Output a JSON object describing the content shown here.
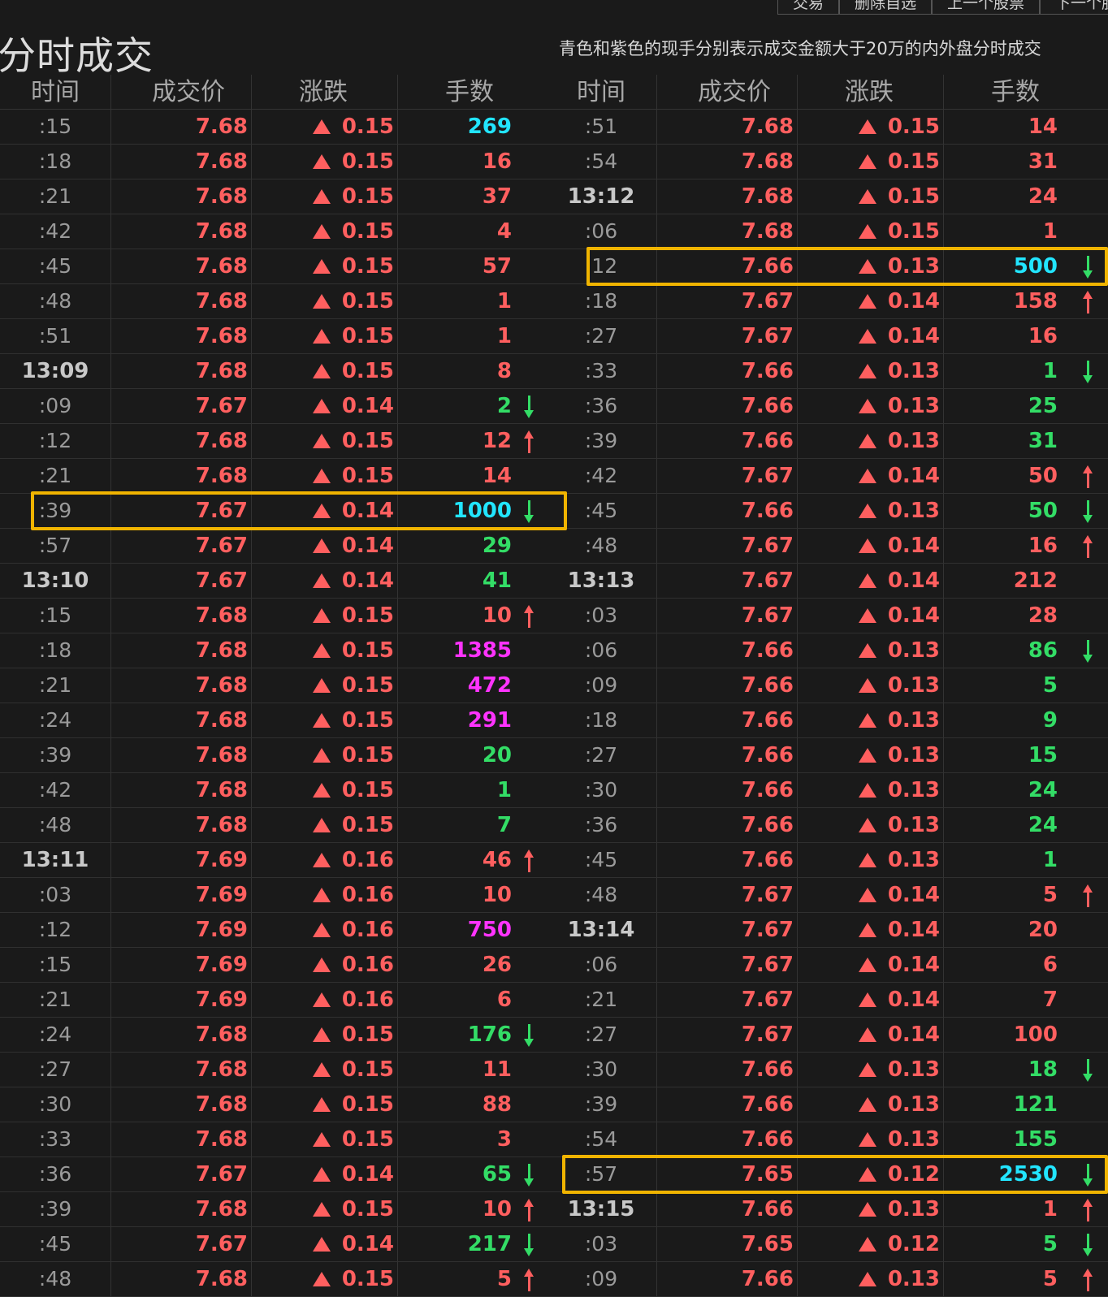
{
  "toolbar": {
    "buttons": [
      "交易",
      "删除自选",
      "上一个股票",
      "下一个股"
    ]
  },
  "title": "分时成交",
  "note": "青色和紫色的现手分别表示成交金额大于20万的内外盘分时成交",
  "columns": [
    "时间",
    "成交价",
    "涨跌",
    "手数"
  ],
  "colors": {
    "up": "#ff5f5f",
    "down": "#33dd66",
    "cyan": "#22e5ff",
    "magenta": "#ff33ff",
    "highlight": "#f0b400"
  },
  "left_rows": [
    {
      "time": ":15",
      "price": "7.68",
      "change": "0.15",
      "volume": "269",
      "vcolor": "cyan",
      "arrow": ""
    },
    {
      "time": ":18",
      "price": "7.68",
      "change": "0.15",
      "volume": "16",
      "vcolor": "up",
      "arrow": ""
    },
    {
      "time": ":21",
      "price": "7.68",
      "change": "0.15",
      "volume": "37",
      "vcolor": "up",
      "arrow": ""
    },
    {
      "time": ":42",
      "price": "7.68",
      "change": "0.15",
      "volume": "4",
      "vcolor": "up",
      "arrow": ""
    },
    {
      "time": ":45",
      "price": "7.68",
      "change": "0.15",
      "volume": "57",
      "vcolor": "up",
      "arrow": ""
    },
    {
      "time": ":48",
      "price": "7.68",
      "change": "0.15",
      "volume": "1",
      "vcolor": "up",
      "arrow": ""
    },
    {
      "time": ":51",
      "price": "7.68",
      "change": "0.15",
      "volume": "1",
      "vcolor": "up",
      "arrow": ""
    },
    {
      "time": "13:09",
      "price": "7.68",
      "change": "0.15",
      "volume": "8",
      "vcolor": "up",
      "arrow": ""
    },
    {
      "time": ":09",
      "price": "7.67",
      "change": "0.14",
      "volume": "2",
      "vcolor": "down",
      "arrow": "down"
    },
    {
      "time": ":12",
      "price": "7.68",
      "change": "0.15",
      "volume": "12",
      "vcolor": "up",
      "arrow": "up"
    },
    {
      "time": ":21",
      "price": "7.68",
      "change": "0.15",
      "volume": "14",
      "vcolor": "up",
      "arrow": ""
    },
    {
      "time": ":39",
      "price": "7.67",
      "change": "0.14",
      "volume": "1000",
      "vcolor": "cyan",
      "arrow": "down"
    },
    {
      "time": ":57",
      "price": "7.67",
      "change": "0.14",
      "volume": "29",
      "vcolor": "down",
      "arrow": ""
    },
    {
      "time": "13:10",
      "price": "7.67",
      "change": "0.14",
      "volume": "41",
      "vcolor": "down",
      "arrow": ""
    },
    {
      "time": ":15",
      "price": "7.68",
      "change": "0.15",
      "volume": "10",
      "vcolor": "up",
      "arrow": "up"
    },
    {
      "time": ":18",
      "price": "7.68",
      "change": "0.15",
      "volume": "1385",
      "vcolor": "magenta",
      "arrow": ""
    },
    {
      "time": ":21",
      "price": "7.68",
      "change": "0.15",
      "volume": "472",
      "vcolor": "magenta",
      "arrow": ""
    },
    {
      "time": ":24",
      "price": "7.68",
      "change": "0.15",
      "volume": "291",
      "vcolor": "magenta",
      "arrow": ""
    },
    {
      "time": ":39",
      "price": "7.68",
      "change": "0.15",
      "volume": "20",
      "vcolor": "down",
      "arrow": ""
    },
    {
      "time": ":42",
      "price": "7.68",
      "change": "0.15",
      "volume": "1",
      "vcolor": "down",
      "arrow": ""
    },
    {
      "time": ":48",
      "price": "7.68",
      "change": "0.15",
      "volume": "7",
      "vcolor": "down",
      "arrow": ""
    },
    {
      "time": "13:11",
      "price": "7.69",
      "change": "0.16",
      "volume": "46",
      "vcolor": "up",
      "arrow": "up"
    },
    {
      "time": ":03",
      "price": "7.69",
      "change": "0.16",
      "volume": "10",
      "vcolor": "up",
      "arrow": ""
    },
    {
      "time": ":12",
      "price": "7.69",
      "change": "0.16",
      "volume": "750",
      "vcolor": "magenta",
      "arrow": ""
    },
    {
      "time": ":15",
      "price": "7.69",
      "change": "0.16",
      "volume": "26",
      "vcolor": "up",
      "arrow": ""
    },
    {
      "time": ":21",
      "price": "7.69",
      "change": "0.16",
      "volume": "6",
      "vcolor": "up",
      "arrow": ""
    },
    {
      "time": ":24",
      "price": "7.68",
      "change": "0.15",
      "volume": "176",
      "vcolor": "down",
      "arrow": "down"
    },
    {
      "time": ":27",
      "price": "7.68",
      "change": "0.15",
      "volume": "11",
      "vcolor": "up",
      "arrow": ""
    },
    {
      "time": ":30",
      "price": "7.68",
      "change": "0.15",
      "volume": "88",
      "vcolor": "up",
      "arrow": ""
    },
    {
      "time": ":33",
      "price": "7.68",
      "change": "0.15",
      "volume": "3",
      "vcolor": "up",
      "arrow": ""
    },
    {
      "time": ":36",
      "price": "7.67",
      "change": "0.14",
      "volume": "65",
      "vcolor": "down",
      "arrow": "down"
    },
    {
      "time": ":39",
      "price": "7.68",
      "change": "0.15",
      "volume": "10",
      "vcolor": "up",
      "arrow": "up"
    },
    {
      "time": ":45",
      "price": "7.67",
      "change": "0.14",
      "volume": "217",
      "vcolor": "down",
      "arrow": "down"
    },
    {
      "time": ":48",
      "price": "7.68",
      "change": "0.15",
      "volume": "5",
      "vcolor": "up",
      "arrow": "up"
    }
  ],
  "right_rows": [
    {
      "time": ":51",
      "price": "7.68",
      "change": "0.15",
      "volume": "14",
      "vcolor": "up",
      "arrow": ""
    },
    {
      "time": ":54",
      "price": "7.68",
      "change": "0.15",
      "volume": "31",
      "vcolor": "up",
      "arrow": ""
    },
    {
      "time": "13:12",
      "price": "7.68",
      "change": "0.15",
      "volume": "24",
      "vcolor": "up",
      "arrow": ""
    },
    {
      "time": ":06",
      "price": "7.68",
      "change": "0.15",
      "volume": "1",
      "vcolor": "up",
      "arrow": ""
    },
    {
      "time": ":12",
      "price": "7.66",
      "change": "0.13",
      "volume": "500",
      "vcolor": "cyan",
      "arrow": "down"
    },
    {
      "time": ":18",
      "price": "7.67",
      "change": "0.14",
      "volume": "158",
      "vcolor": "up",
      "arrow": "up"
    },
    {
      "time": ":27",
      "price": "7.67",
      "change": "0.14",
      "volume": "16",
      "vcolor": "up",
      "arrow": ""
    },
    {
      "time": ":33",
      "price": "7.66",
      "change": "0.13",
      "volume": "1",
      "vcolor": "down",
      "arrow": "down"
    },
    {
      "time": ":36",
      "price": "7.66",
      "change": "0.13",
      "volume": "25",
      "vcolor": "down",
      "arrow": ""
    },
    {
      "time": ":39",
      "price": "7.66",
      "change": "0.13",
      "volume": "31",
      "vcolor": "down",
      "arrow": ""
    },
    {
      "time": ":42",
      "price": "7.67",
      "change": "0.14",
      "volume": "50",
      "vcolor": "up",
      "arrow": "up"
    },
    {
      "time": ":45",
      "price": "7.66",
      "change": "0.13",
      "volume": "50",
      "vcolor": "down",
      "arrow": "down"
    },
    {
      "time": ":48",
      "price": "7.67",
      "change": "0.14",
      "volume": "16",
      "vcolor": "up",
      "arrow": "up"
    },
    {
      "time": "13:13",
      "price": "7.67",
      "change": "0.14",
      "volume": "212",
      "vcolor": "up",
      "arrow": ""
    },
    {
      "time": ":03",
      "price": "7.67",
      "change": "0.14",
      "volume": "28",
      "vcolor": "up",
      "arrow": ""
    },
    {
      "time": ":06",
      "price": "7.66",
      "change": "0.13",
      "volume": "86",
      "vcolor": "down",
      "arrow": "down"
    },
    {
      "time": ":09",
      "price": "7.66",
      "change": "0.13",
      "volume": "5",
      "vcolor": "down",
      "arrow": ""
    },
    {
      "time": ":18",
      "price": "7.66",
      "change": "0.13",
      "volume": "9",
      "vcolor": "down",
      "arrow": ""
    },
    {
      "time": ":27",
      "price": "7.66",
      "change": "0.13",
      "volume": "15",
      "vcolor": "down",
      "arrow": ""
    },
    {
      "time": ":30",
      "price": "7.66",
      "change": "0.13",
      "volume": "24",
      "vcolor": "down",
      "arrow": ""
    },
    {
      "time": ":36",
      "price": "7.66",
      "change": "0.13",
      "volume": "24",
      "vcolor": "down",
      "arrow": ""
    },
    {
      "time": ":45",
      "price": "7.66",
      "change": "0.13",
      "volume": "1",
      "vcolor": "down",
      "arrow": ""
    },
    {
      "time": ":48",
      "price": "7.67",
      "change": "0.14",
      "volume": "5",
      "vcolor": "up",
      "arrow": "up"
    },
    {
      "time": "13:14",
      "price": "7.67",
      "change": "0.14",
      "volume": "20",
      "vcolor": "up",
      "arrow": ""
    },
    {
      "time": ":06",
      "price": "7.67",
      "change": "0.14",
      "volume": "6",
      "vcolor": "up",
      "arrow": ""
    },
    {
      "time": ":21",
      "price": "7.67",
      "change": "0.14",
      "volume": "7",
      "vcolor": "up",
      "arrow": ""
    },
    {
      "time": ":27",
      "price": "7.67",
      "change": "0.14",
      "volume": "100",
      "vcolor": "up",
      "arrow": ""
    },
    {
      "time": ":30",
      "price": "7.66",
      "change": "0.13",
      "volume": "18",
      "vcolor": "down",
      "arrow": "down"
    },
    {
      "time": ":39",
      "price": "7.66",
      "change": "0.13",
      "volume": "121",
      "vcolor": "down",
      "arrow": ""
    },
    {
      "time": ":54",
      "price": "7.66",
      "change": "0.13",
      "volume": "155",
      "vcolor": "down",
      "arrow": ""
    },
    {
      "time": ":57",
      "price": "7.65",
      "change": "0.12",
      "volume": "2530",
      "vcolor": "cyan",
      "arrow": "down"
    },
    {
      "time": "13:15",
      "price": "7.66",
      "change": "0.13",
      "volume": "1",
      "vcolor": "up",
      "arrow": "up"
    },
    {
      "time": ":03",
      "price": "7.65",
      "change": "0.12",
      "volume": "5",
      "vcolor": "down",
      "arrow": "down"
    },
    {
      "time": ":09",
      "price": "7.66",
      "change": "0.13",
      "volume": "5",
      "vcolor": "up",
      "arrow": "up"
    }
  ],
  "highlights": [
    {
      "pane": "left",
      "row": 11
    },
    {
      "pane": "right",
      "row": 4
    },
    {
      "pane": "right",
      "row": 30
    }
  ]
}
